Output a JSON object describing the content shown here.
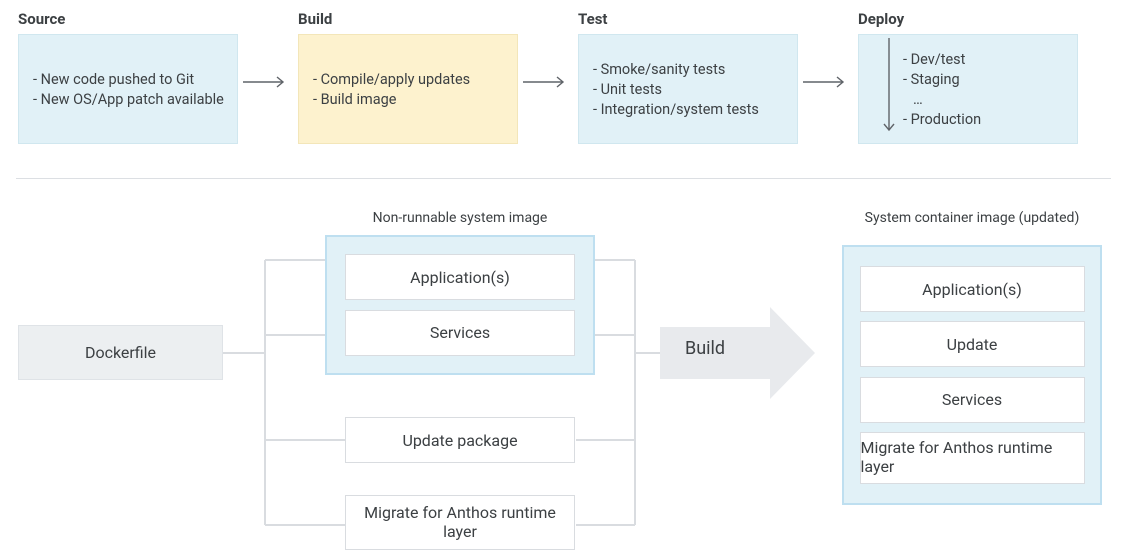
{
  "pipeline": {
    "stages": [
      {
        "title": "Source",
        "style": "blue",
        "items": [
          "- New code pushed to Git",
          "- New OS/App patch available"
        ]
      },
      {
        "title": "Build",
        "style": "yellow",
        "items": [
          "- Compile/apply updates",
          "- Build image"
        ]
      },
      {
        "title": "Test",
        "style": "blue",
        "items": [
          "- Smoke/sanity tests",
          "- Unit tests",
          "- Integration/system tests"
        ]
      },
      {
        "title": "Deploy",
        "style": "blue",
        "items": [
          "- Dev/test",
          "- Staging",
          "…",
          "- Production"
        ]
      }
    ]
  },
  "lower": {
    "dockerfile": "Dockerfile",
    "nonrunnable_label": "Non-runnable system image",
    "nonrunnable_boxes": [
      "Application(s)",
      "Services"
    ],
    "update_box": "Update package",
    "migrate_box": "Migrate for Anthos runtime layer",
    "build_label": "Build",
    "output_label": "System container image (updated)",
    "output_boxes": [
      "Application(s)",
      "Update",
      "Services",
      "Migrate for Anthos runtime layer"
    ]
  }
}
